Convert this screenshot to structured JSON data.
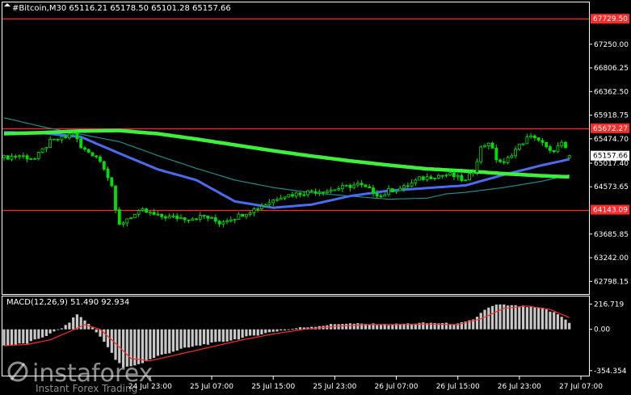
{
  "header": {
    "text": "#Bitcoin,M30  65116.21 65178.50 65101.28 65157.66"
  },
  "macd_header": {
    "text": "MACD(12,26,9) 51.490 92.934"
  },
  "watermark": {
    "brand": "instaforex",
    "tagline": "Instant Forex Trading"
  },
  "colors": {
    "background": "#000000",
    "frame": "#ffffff",
    "candles": "#00e000",
    "ma_thick": "#3cf03c",
    "ma_blue": "#4a6cf0",
    "ma_teal": "#1e8c8c",
    "level_line": "#ff2a2a",
    "level_label_bg": "#ff2a2a",
    "price_label_bg": "#ffffff",
    "macd_hist": "#c8c8c8",
    "macd_signal": "#ff2a2a"
  },
  "chart_data": {
    "type": "candlestick",
    "symbol": "#Bitcoin",
    "timeframe": "M30",
    "ohlc_last": {
      "open": 65116.21,
      "high": 65178.5,
      "low": 65101.28,
      "close": 65157.66
    },
    "ylim": [
      62560,
      68020
    ],
    "y_ticks": [
      "67250.00",
      "66806.25",
      "66362.50",
      "65918.75",
      "65474.70",
      "65017.40",
      "64573.65",
      "63685.85",
      "63242.00",
      "62798.15"
    ],
    "y_tick_values": [
      67250.0,
      66806.25,
      66362.5,
      65918.75,
      65474.7,
      65017.4,
      64573.65,
      63685.85,
      63242.0,
      62798.15
    ],
    "x_ticks": [
      "24 Jul 23:00",
      "25 Jul 07:00",
      "25 Jul 15:00",
      "25 Jul 23:00",
      "26 Jul 07:00",
      "26 Jul 15:00",
      "26 Jul 23:00",
      "27 Jul 07:00"
    ],
    "x_tick_index": [
      38,
      54,
      70,
      86,
      102,
      118,
      134,
      150
    ],
    "current_price": {
      "label": "65157.66",
      "value": 65157.66
    },
    "levels": [
      {
        "label": "67729.50",
        "value": 67729.5
      },
      {
        "label": "65672.27",
        "value": 65672.27
      },
      {
        "label": "64143.09",
        "value": 64143.09
      }
    ],
    "close_anchors": [
      [
        0,
        65120
      ],
      [
        4,
        65160
      ],
      [
        8,
        65100
      ],
      [
        12,
        65420
      ],
      [
        16,
        65500
      ],
      [
        18,
        65600
      ],
      [
        20,
        65300
      ],
      [
        24,
        65150
      ],
      [
        26,
        64950
      ],
      [
        28,
        64600
      ],
      [
        29,
        64100
      ],
      [
        30,
        63850
      ],
      [
        32,
        63980
      ],
      [
        36,
        64120
      ],
      [
        40,
        64020
      ],
      [
        44,
        64000
      ],
      [
        48,
        63980
      ],
      [
        52,
        64020
      ],
      [
        56,
        63900
      ],
      [
        58,
        63960
      ],
      [
        60,
        64000
      ],
      [
        64,
        64120
      ],
      [
        68,
        64250
      ],
      [
        72,
        64400
      ],
      [
        76,
        64440
      ],
      [
        80,
        64490
      ],
      [
        84,
        64500
      ],
      [
        88,
        64560
      ],
      [
        92,
        64620
      ],
      [
        96,
        64480
      ],
      [
        98,
        64400
      ],
      [
        100,
        64500
      ],
      [
        104,
        64560
      ],
      [
        108,
        64720
      ],
      [
        112,
        64780
      ],
      [
        116,
        64800
      ],
      [
        120,
        64680
      ],
      [
        122,
        64880
      ],
      [
        124,
        65300
      ],
      [
        126,
        65420
      ],
      [
        128,
        65100
      ],
      [
        130,
        65000
      ],
      [
        132,
        65200
      ],
      [
        134,
        65350
      ],
      [
        136,
        65480
      ],
      [
        138,
        65520
      ],
      [
        140,
        65380
      ],
      [
        142,
        65220
      ],
      [
        144,
        65320
      ],
      [
        145,
        65380
      ],
      [
        147,
        65160
      ]
    ],
    "ma_fast_anchors": [
      [
        0,
        65600
      ],
      [
        10,
        65580
      ],
      [
        20,
        65510
      ],
      [
        30,
        65200
      ],
      [
        40,
        64900
      ],
      [
        50,
        64700
      ],
      [
        60,
        64300
      ],
      [
        70,
        64180
      ],
      [
        80,
        64240
      ],
      [
        90,
        64400
      ],
      [
        100,
        64500
      ],
      [
        110,
        64550
      ],
      [
        120,
        64600
      ],
      [
        130,
        64800
      ],
      [
        140,
        64980
      ],
      [
        147,
        65090
      ]
    ],
    "ma_medium_anchors": [
      [
        0,
        65870
      ],
      [
        10,
        65700
      ],
      [
        20,
        65560
      ],
      [
        30,
        65420
      ],
      [
        40,
        65160
      ],
      [
        50,
        64920
      ],
      [
        60,
        64700
      ],
      [
        70,
        64560
      ],
      [
        80,
        64460
      ],
      [
        90,
        64400
      ],
      [
        100,
        64340
      ],
      [
        110,
        64360
      ],
      [
        115,
        64440
      ],
      [
        120,
        64470
      ],
      [
        130,
        64560
      ],
      [
        140,
        64680
      ],
      [
        147,
        64800
      ]
    ],
    "ma_slow_anchors": [
      [
        0,
        65570
      ],
      [
        10,
        65590
      ],
      [
        20,
        65620
      ],
      [
        30,
        65630
      ],
      [
        40,
        65570
      ],
      [
        50,
        65470
      ],
      [
        60,
        65360
      ],
      [
        70,
        65250
      ],
      [
        80,
        65150
      ],
      [
        90,
        65060
      ],
      [
        100,
        64980
      ],
      [
        110,
        64910
      ],
      [
        120,
        64870
      ],
      [
        130,
        64820
      ],
      [
        140,
        64780
      ],
      [
        147,
        64760
      ]
    ],
    "macd": {
      "params": "12,26,9",
      "main": 51.49,
      "signal": 92.934,
      "ylim": [
        -390,
        275
      ],
      "y_ticks": [
        "216.719",
        "0.00",
        "-354.354"
      ],
      "y_tick_values": [
        216.719,
        0.0,
        -354.354
      ],
      "hist_anchors": [
        [
          0,
          -140
        ],
        [
          6,
          -120
        ],
        [
          12,
          -40
        ],
        [
          16,
          30
        ],
        [
          19,
          130
        ],
        [
          22,
          50
        ],
        [
          26,
          -100
        ],
        [
          29,
          -260
        ],
        [
          31,
          -330
        ],
        [
          35,
          -300
        ],
        [
          40,
          -230
        ],
        [
          46,
          -170
        ],
        [
          52,
          -130
        ],
        [
          58,
          -100
        ],
        [
          64,
          -60
        ],
        [
          70,
          -20
        ],
        [
          76,
          10
        ],
        [
          82,
          30
        ],
        [
          88,
          50
        ],
        [
          94,
          45
        ],
        [
          100,
          40
        ],
        [
          106,
          50
        ],
        [
          112,
          55
        ],
        [
          118,
          45
        ],
        [
          122,
          80
        ],
        [
          125,
          170
        ],
        [
          128,
          210
        ],
        [
          134,
          200
        ],
        [
          140,
          180
        ],
        [
          144,
          130
        ],
        [
          147,
          60
        ]
      ],
      "signal_anchors": [
        [
          0,
          -140
        ],
        [
          6,
          -130
        ],
        [
          12,
          -90
        ],
        [
          17,
          -20
        ],
        [
          21,
          40
        ],
        [
          25,
          0
        ],
        [
          29,
          -120
        ],
        [
          33,
          -250
        ],
        [
          38,
          -270
        ],
        [
          46,
          -210
        ],
        [
          54,
          -150
        ],
        [
          62,
          -90
        ],
        [
          70,
          -40
        ],
        [
          78,
          0
        ],
        [
          86,
          25
        ],
        [
          94,
          40
        ],
        [
          102,
          40
        ],
        [
          110,
          45
        ],
        [
          118,
          40
        ],
        [
          124,
          90
        ],
        [
          130,
          180
        ],
        [
          136,
          200
        ],
        [
          142,
          170
        ],
        [
          147,
          100
        ]
      ]
    }
  }
}
